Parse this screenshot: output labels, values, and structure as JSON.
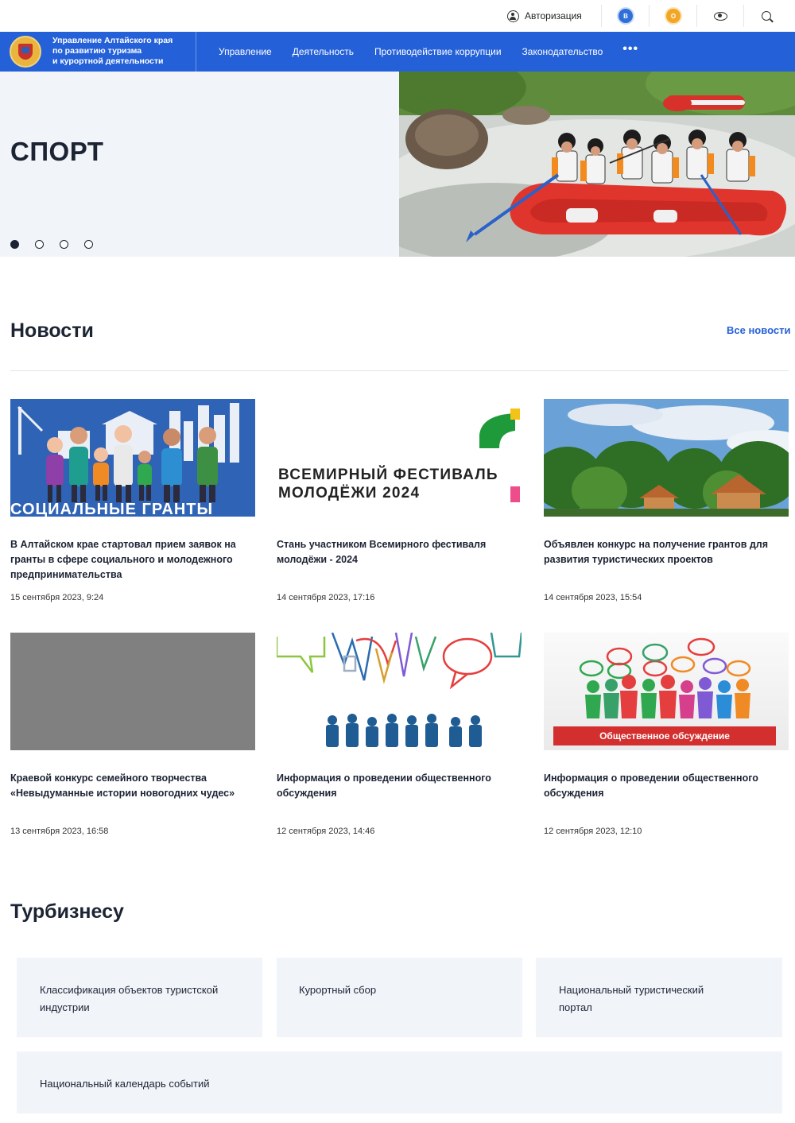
{
  "utility": {
    "auth_label": "Авторизация",
    "coin_blue_icon": "vk-icon",
    "coin_gold_icon": "ok-icon",
    "accessibility_icon": "eye-icon",
    "search_icon": "search-icon"
  },
  "header": {
    "org_line1": "Управление Алтайского края",
    "org_line2": "по развитию туризма",
    "org_line3": "и курортной деятельности",
    "nav": [
      {
        "label": "Управление"
      },
      {
        "label": "Деятельность"
      },
      {
        "label": "Противодействие коррупции"
      },
      {
        "label": "Законодательство"
      }
    ],
    "more": "•••"
  },
  "hero": {
    "title": "СПОРТ",
    "slide_count": 4,
    "active_slide": 1
  },
  "news": {
    "heading": "Новости",
    "all_link": "Все новости",
    "items": [
      {
        "title": "В Алтайском крае стартовал прием заявок на гранты в сфере социального и молодежного предпринимательства",
        "date": "15 сентября 2023, 9:24",
        "image_caption": "СОЦИАЛЬНЫЕ ГРАНТЫ"
      },
      {
        "title": "Стань участником Всемирного фестиваля молодёжи - 2024",
        "date": "14 сентября 2023, 17:16",
        "image_caption_line1": "ВСЕМИРНЫЙ ФЕСТИВАЛЬ",
        "image_caption_line2": "МОЛОДЁЖИ 2024"
      },
      {
        "title": "Объявлен конкурс на получение грантов для развития туристических проектов",
        "date": "14 сентября 2023, 15:54"
      },
      {
        "title": "Краевой конкурс семейного творчества «Невыдуманные истории новогодних чудес»",
        "date": "13 сентября 2023, 16:58"
      },
      {
        "title": "Информация о проведении общественного обсуждения",
        "date": "12 сентября 2023, 14:46"
      },
      {
        "title": "Информация о проведении общественного обсуждения",
        "date": "12 сентября 2023, 12:10",
        "image_caption": "Общественное обсуждение"
      }
    ]
  },
  "turbiz": {
    "heading": "Турбизнесу",
    "tiles": [
      {
        "label": "Классификация объектов туристской индустрии"
      },
      {
        "label": "Курортный сбор"
      },
      {
        "label": "Национальный туристический портал"
      },
      {
        "label": "Национальный календарь событий"
      }
    ]
  }
}
